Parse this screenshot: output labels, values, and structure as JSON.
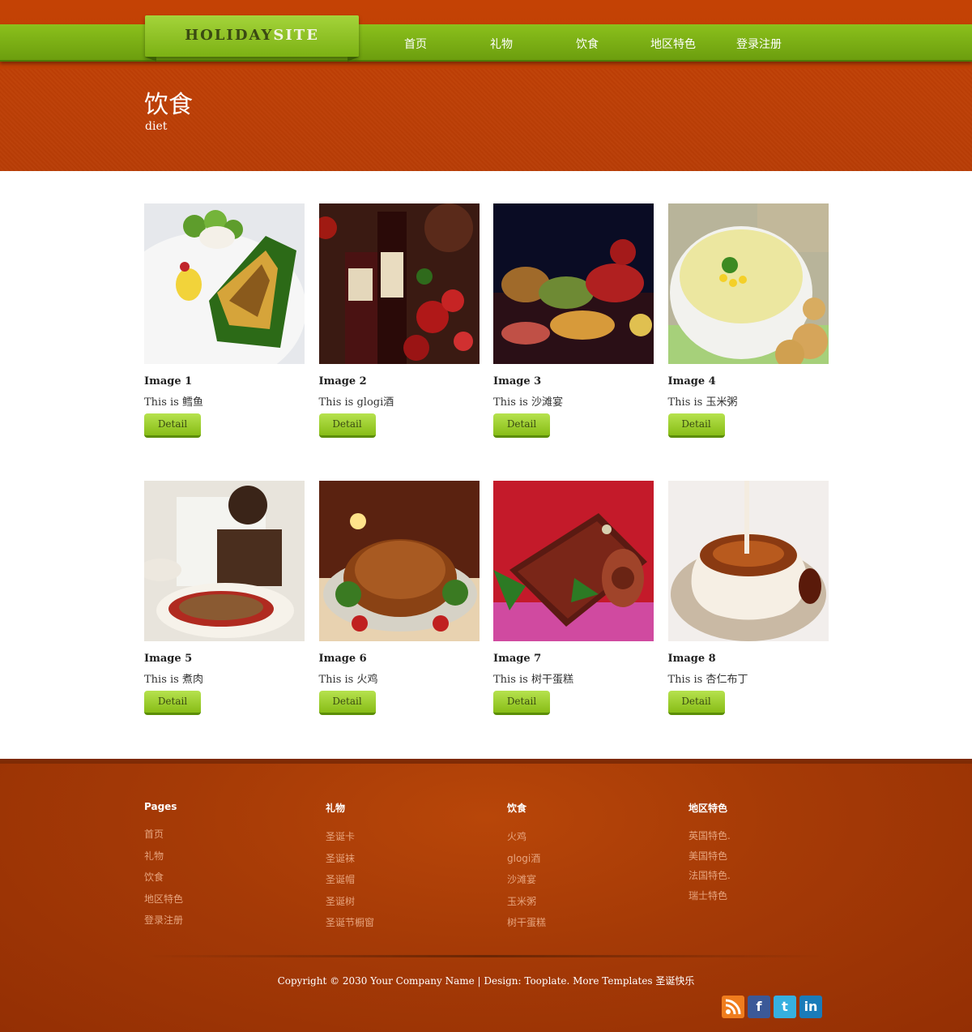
{
  "header": {
    "logo_part1": "HOLIDAY",
    "logo_part2": "SITE",
    "nav": [
      "首页",
      "礼物",
      "饮食",
      "地区特色",
      "登录注册"
    ]
  },
  "banner": {
    "title": "饮食",
    "subtitle": "diet"
  },
  "gallery": {
    "detail_label": "Detail",
    "items": [
      {
        "title": "Image 1",
        "desc": "This is 鳕鱼"
      },
      {
        "title": "Image 2",
        "desc": "This is glogi酒"
      },
      {
        "title": "Image 3",
        "desc": "This is 沙滩宴"
      },
      {
        "title": "Image 4",
        "desc": "This is 玉米粥"
      },
      {
        "title": "Image 5",
        "desc": "This is 煮肉"
      },
      {
        "title": "Image 6",
        "desc": "This is 火鸡"
      },
      {
        "title": "Image 7",
        "desc": "This is 树干蛋糕"
      },
      {
        "title": "Image 8",
        "desc": "This is 杏仁布丁"
      }
    ]
  },
  "footer": {
    "columns": [
      {
        "heading": "Pages",
        "links": [
          "首页",
          "礼物",
          "饮食",
          "地区特色",
          "登录注册"
        ]
      },
      {
        "heading": "礼物",
        "links": [
          "圣诞卡",
          "圣诞袜",
          "圣诞帽",
          "圣诞树",
          "圣诞节橱窗"
        ]
      },
      {
        "heading": "饮食",
        "links": [
          "火鸡",
          "glogi酒",
          "沙滩宴",
          "玉米粥",
          "树干蛋糕"
        ]
      },
      {
        "heading": "地区特色",
        "links": [
          "英国特色.",
          "美国特色",
          "法国特色.",
          "瑞士特色"
        ]
      }
    ],
    "copyright": "Copyright © 2030 Your Company Name | Design: Tooplate. More Templates 圣诞快乐",
    "social": [
      "rss-icon",
      "facebook-icon",
      "twitter-icon",
      "linkedin-icon"
    ]
  },
  "colors": {
    "header_red": "#c44205",
    "nav_green": "#7cb114",
    "button_green": "#9acd2a",
    "footer_red": "#a53a06"
  }
}
